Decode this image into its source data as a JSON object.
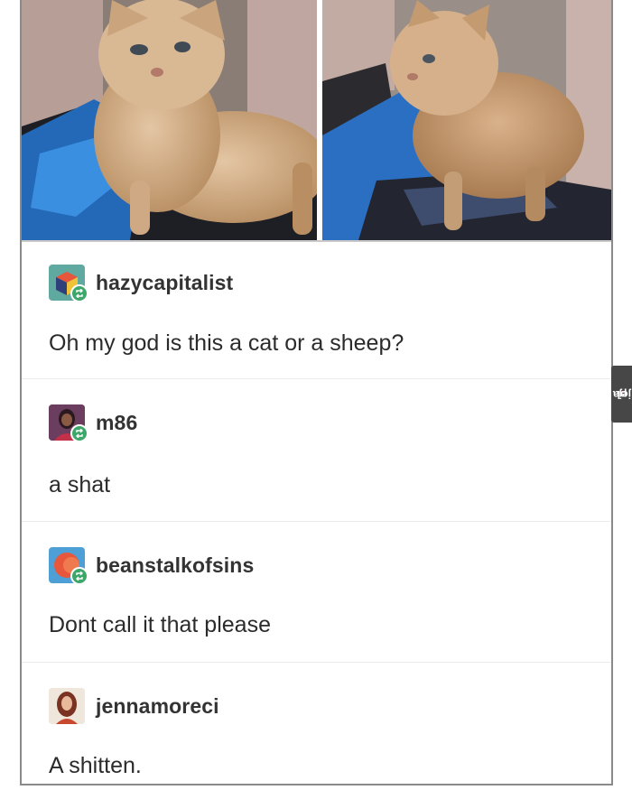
{
  "posts": [
    {
      "username": "hazycapitalist",
      "text": "Oh my god is this a cat or a sheep?",
      "avatar_icon": "cube-avatar-icon"
    },
    {
      "username": "m86",
      "text": "a shat",
      "avatar_icon": "user-photo-avatar"
    },
    {
      "username": "beanstalkofsins",
      "text": "Dont call it that please",
      "avatar_icon": "circle-avatar-icon"
    },
    {
      "username": "jennamoreci",
      "text": "A shitten.",
      "avatar_icon": "user-photo-avatar"
    }
  ],
  "watermark": {
    "brand": "jeja",
    "dot": ".",
    "tld": "pl"
  },
  "colors": {
    "reblog_badge": "#3da76a",
    "border": "#8a8a8a",
    "text": "#2b2b2b"
  }
}
